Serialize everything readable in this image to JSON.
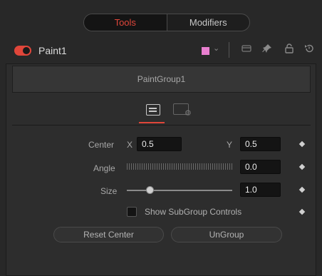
{
  "tabs": {
    "tools": "Tools",
    "modifiers": "Modifiers",
    "active": "tools"
  },
  "colors": {
    "accent": "#e0463a",
    "node_swatch": "#e87fcf"
  },
  "node": {
    "name": "Paint1"
  },
  "header_icons": [
    "chevron-down-icon",
    "view-icon",
    "pin-icon",
    "lock-icon",
    "reset-icon"
  ],
  "group": {
    "name": "PaintGroup1"
  },
  "inspector_tabs": [
    "controls-icon",
    "settings-icon"
  ],
  "controls": {
    "center": {
      "label": "Center",
      "x_label": "X",
      "x_value": "0.5",
      "y_label": "Y",
      "y_value": "0.5"
    },
    "angle": {
      "label": "Angle",
      "value": "0.0"
    },
    "size": {
      "label": "Size",
      "value": "1.0",
      "slider_fraction": 0.22
    },
    "show_subgroup": {
      "label": "Show SubGroup Controls",
      "checked": false
    }
  },
  "buttons": {
    "reset_center": "Reset Center",
    "ungroup": "UnGroup"
  }
}
